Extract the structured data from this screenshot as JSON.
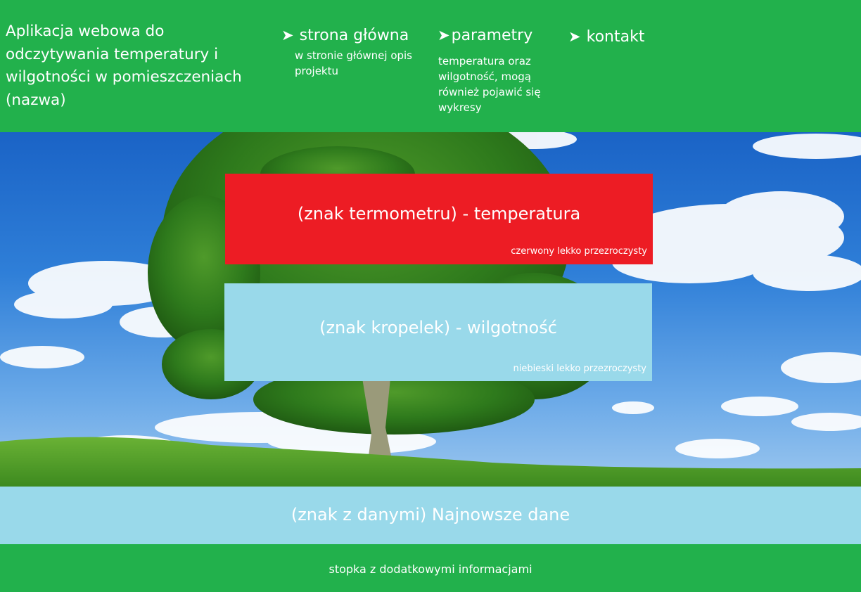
{
  "colors": {
    "header_bg": "#22b14c",
    "footer_bg": "#22b14c",
    "temperature_card": "#ed1c24",
    "humidity_card": "#99d9ea",
    "data_bar": "#99d9ea",
    "text": "#ffffff"
  },
  "header": {
    "app_title": "Aplikacja webowa do odczytywania temperatury i wilgotności w pomieszczeniach (nazwa)",
    "nav": [
      {
        "icon": "arrow-right-icon",
        "arrow": "➤",
        "label": "strona główna",
        "description": "w stronie głównej opis projektu"
      },
      {
        "icon": "arrow-right-icon",
        "arrow": "➤",
        "label": "parametry",
        "description": "temperatura oraz wilgotność, mogą również pojawić się wykresy"
      },
      {
        "icon": "arrow-right-icon",
        "arrow": "➤",
        "label": "kontakt"
      }
    ]
  },
  "hero": {
    "background": "tree-landscape-image",
    "temperature": {
      "label": "(znak termometru) - temperatura",
      "note": "czerwony lekko przezroczysty"
    },
    "humidity": {
      "label": "(znak kropelek) - wilgotność",
      "note": "niebieski lekko przezroczysty"
    }
  },
  "latest_data": {
    "label": "(znak z danymi) Najnowsze dane"
  },
  "footer": {
    "text": "stopka z dodatkowymi informacjami"
  }
}
